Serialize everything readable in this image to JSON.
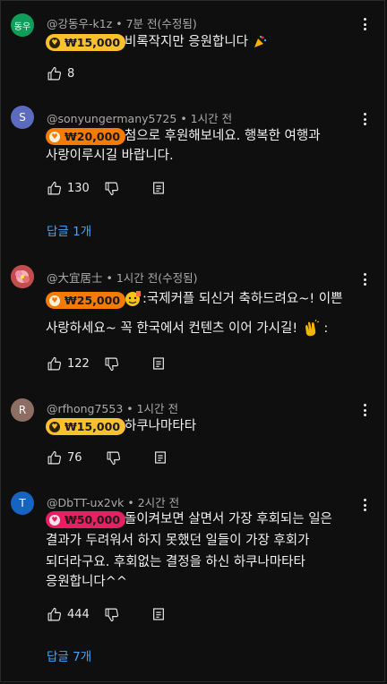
{
  "colors": {
    "background": "#0f0f0f",
    "meta_text": "#aaaaaa",
    "link_blue": "#3ea6ff",
    "pill_yellow": "#fbc02d",
    "pill_orange": "#f57c00",
    "pill_pink": "#e91e63"
  },
  "comments": [
    {
      "avatar_text": "동우",
      "author": "@강동우-k1z",
      "time": "7분 전(수정됨)",
      "amount": "₩15,000",
      "lines": [
        "비록작지만 응원합니다"
      ],
      "likes": "8"
    },
    {
      "avatar_text": "S",
      "author": "@sonyungermany5725",
      "time": "1시간 전",
      "amount": "₩20,000",
      "lines": [
        "첨으로 후원해보네요. 행복한 여행과",
        "사랑이루시길 바랍니다."
      ],
      "likes": "130",
      "reply": "답글 1개"
    },
    {
      "author": "@大宜居士",
      "time": "1시간 전(수정됨)",
      "amount": "₩25,000",
      "lines": [
        ":국제커플 되신거 축하드려요~! 이쁜",
        "사랑하세요~ 꼭 한국에서 컨텐츠 이어 가시길!",
        " :"
      ],
      "likes": "122"
    },
    {
      "avatar_text": "R",
      "author": "@rfhong7553",
      "time": "1시간 전",
      "amount": "₩15,000",
      "lines": [
        "하쿠나마타타"
      ],
      "likes": "76"
    },
    {
      "avatar_text": "T",
      "author": "@DbTT-ux2vk",
      "time": "2시간 전",
      "amount": "₩50,000",
      "lines": [
        "돌이켜보면 살면서 가장 후회되는 일은",
        "결과가 두려워서 하지 못했던 일들이 가장 후회가",
        "되더라구요. 후회없는 결정을 하신 하쿠나마타타",
        "응원합니다^^"
      ],
      "likes": "444",
      "reply": "답글 7개"
    }
  ],
  "icons": {
    "like": "thumbs-up-icon",
    "dislike": "thumbs-down-icon",
    "reply": "reply-icon",
    "more": "more-vert-icon",
    "coin": "super-thanks-coin-icon"
  }
}
